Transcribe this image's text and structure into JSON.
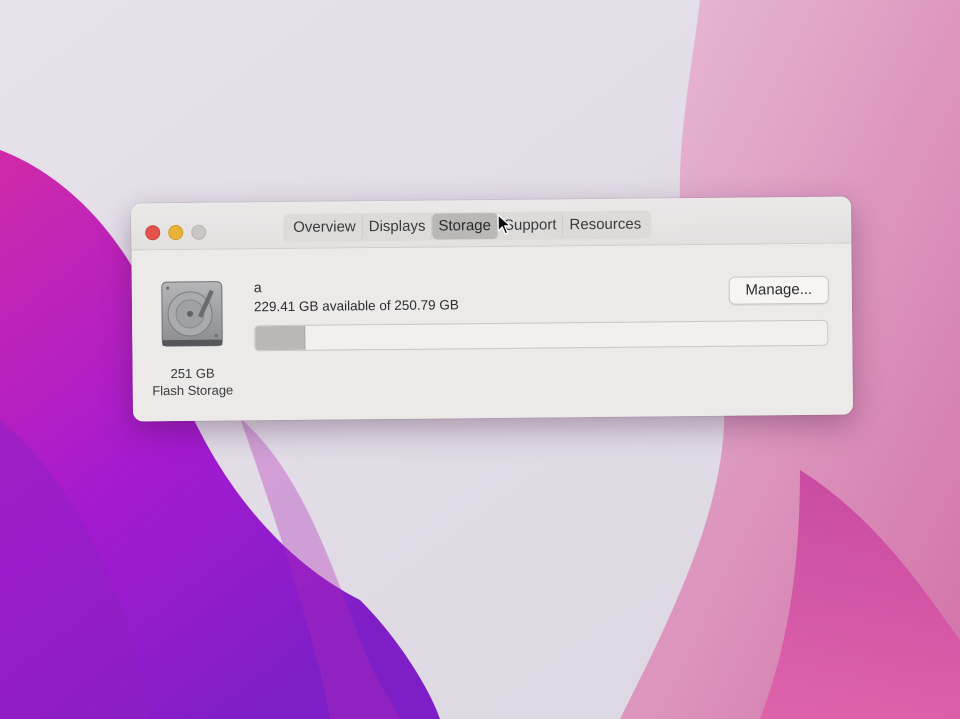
{
  "window": {
    "tabs": [
      {
        "label": "Overview",
        "active": false
      },
      {
        "label": "Displays",
        "active": false
      },
      {
        "label": "Storage",
        "active": true
      },
      {
        "label": "Support",
        "active": false
      },
      {
        "label": "Resources",
        "active": false
      }
    ]
  },
  "storage": {
    "disk_size": "251 GB",
    "disk_type": "Flash Storage",
    "volume_name": "a",
    "availability": "229.41 GB available of 250.79 GB",
    "used_fraction": 0.0853,
    "manage_label": "Manage..."
  },
  "colors": {
    "close": "#e4534b",
    "minimize": "#e9b33a",
    "zoom": "#c9c7c6",
    "bar_used": "#b9b8b6"
  },
  "icons": {
    "disk": "hard-drive-icon",
    "cursor": "mouse-pointer-icon"
  }
}
